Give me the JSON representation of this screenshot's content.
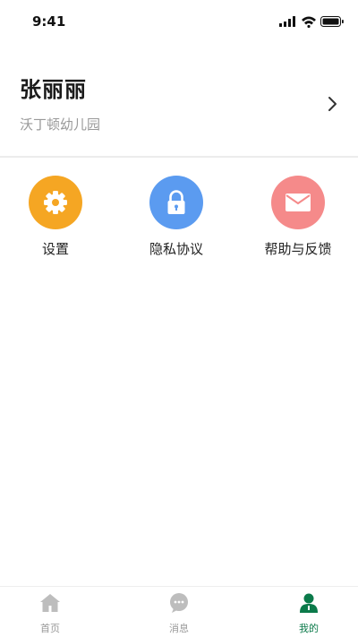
{
  "status_bar": {
    "time": "9:41"
  },
  "profile": {
    "name": "张丽丽",
    "school": "沃丁顿幼儿园"
  },
  "menu": {
    "items": [
      {
        "label": "设置",
        "icon": "gear-icon",
        "color": "#f5a623"
      },
      {
        "label": "隐私协议",
        "icon": "lock-icon",
        "color": "#5b9bf0"
      },
      {
        "label": "帮助与反馈",
        "icon": "mail-icon",
        "color": "#f58a8a"
      }
    ]
  },
  "tabbar": {
    "tabs": [
      {
        "label": "首页",
        "icon": "home-icon",
        "active": false
      },
      {
        "label": "消息",
        "icon": "message-icon",
        "active": false
      },
      {
        "label": "我的",
        "icon": "person-icon",
        "active": true
      }
    ],
    "active_color": "#0b7a4a",
    "inactive_color": "#999999"
  }
}
